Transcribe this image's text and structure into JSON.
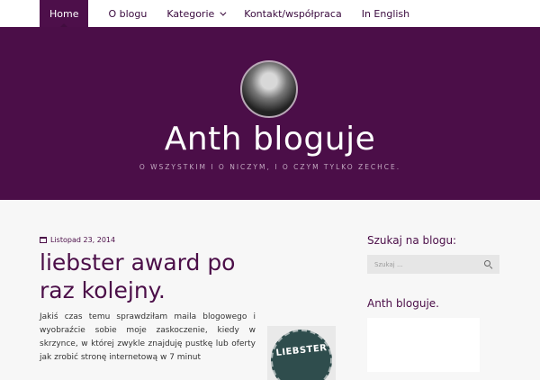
{
  "nav": {
    "items": [
      {
        "label": "Home",
        "active": true
      },
      {
        "label": "O blogu",
        "active": false
      },
      {
        "label": "Kategorie",
        "active": false
      },
      {
        "label": "Kontakt/współpraca",
        "active": false
      },
      {
        "label": "In English",
        "active": false
      }
    ]
  },
  "header": {
    "title": "Anth bloguje",
    "tagline": "O wszystkim i o niczym, i o czym tylko zechce."
  },
  "post": {
    "date": "Listopad 23, 2014",
    "title": "liebster award po raz kolejny.",
    "excerpt": "Jakiś czas temu sprawdziłam maila blogowego i wyobraźcie sobie moje zaskoczenie, kiedy w skrzynce, w której zwykle znajduję pustkę lub oferty jak zrobić stronę internetową w 7 minut",
    "badge_text": "LIEBSTER"
  },
  "sidebar": {
    "search_heading": "Szukaj na blogu:",
    "search_placeholder": "Szukaj ...",
    "about_heading": "Anth bloguje."
  },
  "colors": {
    "brand": "#4b0e48",
    "nav_active": "#4d0f4a"
  }
}
